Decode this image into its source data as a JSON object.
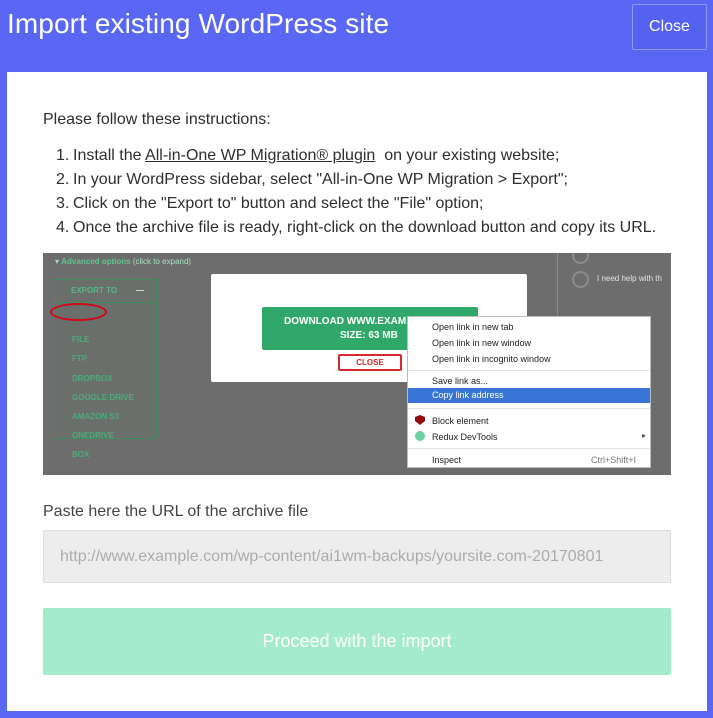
{
  "dialog": {
    "title": "Import existing WordPress site",
    "close_label": "Close"
  },
  "instructions": {
    "intro": "Please follow these instructions:",
    "steps": [
      {
        "num": "1.",
        "pre": "Install the ",
        "link": "All-in-One WP Migration® plugin",
        "post": "  on your existing website;"
      },
      {
        "num": "2.",
        "text": "In your WordPress sidebar, select \"All-in-One WP Migration > Export\";"
      },
      {
        "num": "3.",
        "text": "Click on the \"Export to\" button and select the \"File\" option;"
      },
      {
        "num": "4.",
        "text": "Once the archive file is ready, right-click on the download button and copy its URL."
      }
    ]
  },
  "illustration": {
    "advanced_options": "Advanced options",
    "click_to_expand": "(click to expand)",
    "export_to": "EXPORT TO",
    "export_items": [
      "FILE",
      "FTP",
      "DROPBOX",
      "GOOGLE DRIVE",
      "AMAZON S3",
      "ONEDRIVE",
      "BOX"
    ],
    "help_text": "I need help with th",
    "download_line1": "DOWNLOAD WWW.EXAM",
    "download_line2": "SIZE: 63 MB",
    "close_button": "CLOSE",
    "context_menu": {
      "open_new_tab": "Open link in new tab",
      "open_new_window": "Open link in new window",
      "open_incognito": "Open link in incognito window",
      "save_link": "Save link as...",
      "copy_link": "Copy link address",
      "block_element": "Block element",
      "redux_devtools": "Redux DevTools",
      "inspect": "Inspect",
      "inspect_shortcut": "Ctrl+Shift+I"
    }
  },
  "url_field": {
    "label": "Paste here the URL of the archive file",
    "value": "",
    "placeholder": "http://www.example.com/wp-content/ai1wm-backups/yoursite.com-20170801"
  },
  "proceed_button": {
    "label": "Proceed with the import"
  },
  "colors": {
    "header_bg": "#5a67f4",
    "proceed_bg": "#a4ebcb",
    "accent_green": "#2fa869",
    "highlight_blue": "#3875d7"
  }
}
